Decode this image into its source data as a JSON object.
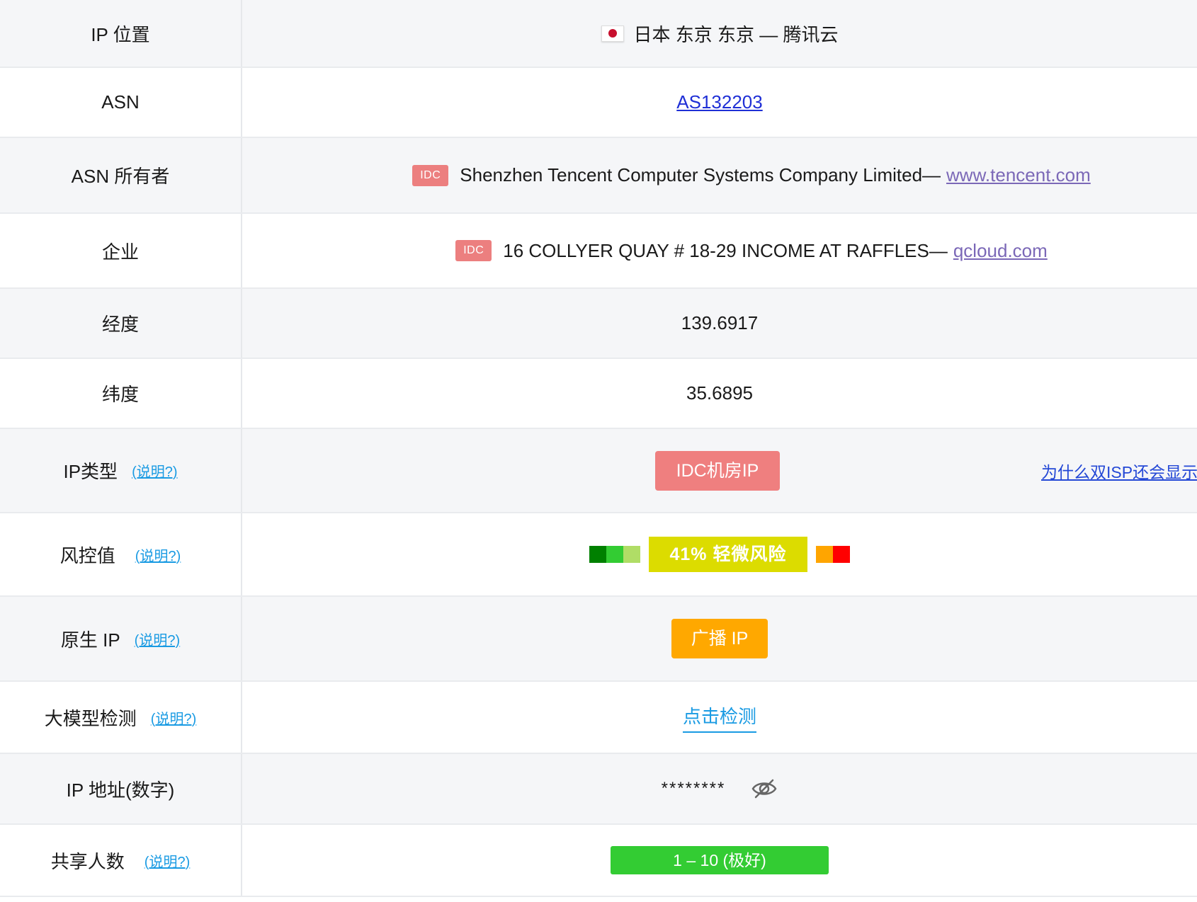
{
  "rows": {
    "location": {
      "label": "IP 位置",
      "flag_icon": "japan-flag-icon",
      "value": "日本 东京 东京 — 腾讯云"
    },
    "asn": {
      "label": "ASN",
      "value": "AS132203"
    },
    "asn_owner": {
      "label": "ASN 所有者",
      "tag": "IDC",
      "name": "Shenzhen Tencent Computer Systems Company Limited—",
      "site": "www.tencent.com"
    },
    "company": {
      "label": "企业",
      "tag": "IDC",
      "name": "16 COLLYER QUAY # 18-29 INCOME AT RAFFLES—",
      "site": "qcloud.com"
    },
    "longitude": {
      "label": "经度",
      "value": "139.6917"
    },
    "latitude": {
      "label": "纬度",
      "value": "35.6895"
    },
    "ip_type": {
      "label": "IP类型",
      "help": "(说明?)",
      "badge": "IDC机房IP",
      "why_link": "为什么双ISP还会显示"
    },
    "risk": {
      "label": "风控值",
      "help": "(说明?)",
      "score_label": "41%  轻微风险",
      "score_percent": 41,
      "segment_colors": [
        "#008000",
        "#33cc33",
        "#b0dd66",
        "#dcdc00",
        "#ffa500",
        "#ff0000"
      ]
    },
    "native": {
      "label": "原生 IP",
      "help": "(说明?)",
      "badge": "广播 IP"
    },
    "llm": {
      "label": "大模型检测",
      "help": "(说明?)",
      "action": "点击检测"
    },
    "ip_numeric": {
      "label": "IP 地址(数字)",
      "masked_value": "********",
      "toggle_icon": "eye-slash-icon"
    },
    "shared": {
      "label": "共享人数",
      "help": "(说明?)",
      "value": "1 – 10 (极好)"
    }
  },
  "colors": {
    "idc_tag": "#ec7f7f",
    "risk_yellow": "#dcdc00",
    "native_orange": "#ffa800",
    "shared_green": "#33cc33",
    "help_link": "#1a9be3"
  }
}
